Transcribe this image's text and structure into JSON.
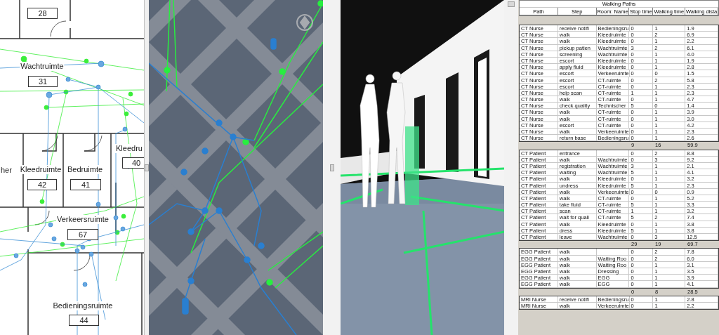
{
  "floor_plan": {
    "rooms": [
      {
        "number": "28"
      },
      {
        "label": "Wachtruimte",
        "number": "31"
      },
      {
        "label": "her"
      },
      {
        "label": "Kleedruimte",
        "number": "42"
      },
      {
        "label": "Bedruimte",
        "number": "41"
      },
      {
        "label": "Kleedru",
        "number": "40"
      },
      {
        "label": "Verkeersruimte",
        "number": "67"
      },
      {
        "label": "Bedieningsruimte",
        "number": "44"
      }
    ]
  },
  "table": {
    "title": "Walking Paths",
    "columns": [
      "Path",
      "Step",
      "Room: Name",
      "Stop time",
      "Walking time",
      "Walking dista"
    ],
    "groups": [
      {
        "rows": [
          {
            "path": "CT Nurse",
            "step": "receive notifi",
            "room": "Bedieningsru",
            "stop": "0",
            "walk": "1",
            "dist": "1.9"
          },
          {
            "path": "CT Nurse",
            "step": "walk",
            "room": "Kleedruimte",
            "stop": "0",
            "walk": "2",
            "dist": "6.9"
          },
          {
            "path": "CT Nurse",
            "step": "walk",
            "room": "Kleedruimte",
            "stop": "0",
            "walk": "1",
            "dist": "2.2"
          },
          {
            "path": "CT Nurse",
            "step": "pickup patien",
            "room": "Wachtruimte",
            "stop": "3",
            "walk": "2",
            "dist": "6.1"
          },
          {
            "path": "CT Nurse",
            "step": "screening",
            "room": "Wachtruimte",
            "stop": "0",
            "walk": "1",
            "dist": "4.0"
          },
          {
            "path": "CT Nurse",
            "step": "escort",
            "room": "Kleedruimte",
            "stop": "0",
            "walk": "1",
            "dist": "1.9"
          },
          {
            "path": "CT Nurse",
            "step": "apply fluid",
            "room": "Kleedruimte",
            "stop": "0",
            "walk": "1",
            "dist": "2.8"
          },
          {
            "path": "CT Nurse",
            "step": "escort",
            "room": "Verkeeruimte",
            "stop": "0",
            "walk": "0",
            "dist": "1.5"
          },
          {
            "path": "CT Nurse",
            "step": "escort",
            "room": "CT-ruimte",
            "stop": "0",
            "walk": "2",
            "dist": "5.8"
          },
          {
            "path": "CT Nurse",
            "step": "escort",
            "room": "CT-ruimte",
            "stop": "0",
            "walk": "1",
            "dist": "2.3"
          },
          {
            "path": "CT Nurse",
            "step": "help scan",
            "room": "CT-ruimte",
            "stop": "1",
            "walk": "1",
            "dist": "2.3"
          },
          {
            "path": "CT Nurse",
            "step": "walk",
            "room": "CT-ruimte",
            "stop": "0",
            "walk": "1",
            "dist": "4.7"
          },
          {
            "path": "CT Nurse",
            "step": "check quality",
            "room": "Technischer",
            "stop": "5",
            "walk": "0",
            "dist": "1.4"
          },
          {
            "path": "CT Nurse",
            "step": "walk",
            "room": "CT-ruimte",
            "stop": "0",
            "walk": "1",
            "dist": "3.9"
          },
          {
            "path": "CT Nurse",
            "step": "walk",
            "room": "CT-ruimte",
            "stop": "0",
            "walk": "1",
            "dist": "3.0"
          },
          {
            "path": "CT Nurse",
            "step": "escort",
            "room": "CT-ruimte",
            "stop": "0",
            "walk": "1",
            "dist": "4.2"
          },
          {
            "path": "CT Nurse",
            "step": "walk",
            "room": "Verkeeruimte",
            "stop": "0",
            "walk": "1",
            "dist": "2.3"
          },
          {
            "path": "CT Nurse",
            "step": "return base",
            "room": "Bedieningsru",
            "stop": "0",
            "walk": "1",
            "dist": "2.6"
          }
        ],
        "totals": {
          "stop": "9",
          "walk": "16",
          "dist": "59.9"
        }
      },
      {
        "rows": [
          {
            "path": "CT Patient",
            "step": "entrance",
            "stop": "0",
            "walk": "2",
            "dist": "8.8"
          },
          {
            "path": "CT Patient",
            "step": "walk",
            "room": "Wachtruimte",
            "stop": "0",
            "walk": "3",
            "dist": "9.2"
          },
          {
            "path": "CT Patient",
            "step": "registration",
            "room": "Wachtruimte",
            "stop": "3",
            "walk": "1",
            "dist": "2.1"
          },
          {
            "path": "CT Patient",
            "step": "waiting",
            "room": "Wachtruimte",
            "stop": "5",
            "walk": "1",
            "dist": "4.1"
          },
          {
            "path": "CT Patient",
            "step": "walk",
            "room": "Kleedruimte",
            "stop": "0",
            "walk": "1",
            "dist": "3.2"
          },
          {
            "path": "CT Patient",
            "step": "undress",
            "room": "Kleedruimte",
            "stop": "5",
            "walk": "1",
            "dist": "2.3"
          },
          {
            "path": "CT Patient",
            "step": "walk",
            "room": "Verkeeruimte",
            "stop": "0",
            "walk": "0",
            "dist": "0.9"
          },
          {
            "path": "CT Patient",
            "step": "walk",
            "room": "CT-ruimte",
            "stop": "0",
            "walk": "1",
            "dist": "5.2"
          },
          {
            "path": "CT Patient",
            "step": "take fluid",
            "room": "CT-ruimte",
            "stop": "5",
            "walk": "1",
            "dist": "3.3"
          },
          {
            "path": "CT Patient",
            "step": "scan",
            "room": "CT-ruimte",
            "stop": "1",
            "walk": "1",
            "dist": "3.2"
          },
          {
            "path": "CT Patient",
            "step": "wait for quali",
            "room": "CT-ruimte",
            "stop": "5",
            "walk": "2",
            "dist": "7.4"
          },
          {
            "path": "CT Patient",
            "step": "walk",
            "room": "Kleedruimte",
            "stop": "0",
            "walk": "1",
            "dist": "3.8"
          },
          {
            "path": "CT Patient",
            "step": "dress",
            "room": "Kleedruimte",
            "stop": "5",
            "walk": "1",
            "dist": "3.8"
          },
          {
            "path": "CT Patient",
            "step": "leave",
            "room": "Wachtruimte",
            "stop": "0",
            "walk": "3",
            "dist": "12.5"
          }
        ],
        "totals": {
          "stop": "29",
          "walk": "19",
          "dist": "69.7"
        }
      },
      {
        "rows": [
          {
            "path": "EGG Patient",
            "step": "walk",
            "stop": "0",
            "walk": "2",
            "dist": "7.8"
          },
          {
            "path": "EGG Patient",
            "step": "walk",
            "room": "Waiting Roo",
            "stop": "0",
            "walk": "2",
            "dist": "6.0"
          },
          {
            "path": "EGG Patient",
            "step": "walk",
            "room": "Waiting Roo",
            "stop": "0",
            "walk": "1",
            "dist": "3.1"
          },
          {
            "path": "EGG Patient",
            "step": "walk",
            "room": "Dressing",
            "stop": "0",
            "walk": "1",
            "dist": "3.5"
          },
          {
            "path": "EGG Patient",
            "step": "walk",
            "room": "EGG",
            "stop": "0",
            "walk": "1",
            "dist": "3.9"
          },
          {
            "path": "EGG Patient",
            "step": "walk",
            "room": "EGG",
            "stop": "0",
            "walk": "1",
            "dist": "4.1"
          }
        ],
        "totals": {
          "stop": "0",
          "walk": "8",
          "dist": "28.5"
        }
      },
      {
        "rows": [
          {
            "path": "MRI Nurse",
            "step": "receive notifi",
            "room": "Bedieningsru",
            "stop": "0",
            "walk": "1",
            "dist": "2.8"
          },
          {
            "path": "MRI Nurse",
            "step": "walk",
            "room": "Verkeeruimte",
            "stop": "0",
            "walk": "1",
            "dist": "2.2"
          }
        ]
      }
    ]
  }
}
